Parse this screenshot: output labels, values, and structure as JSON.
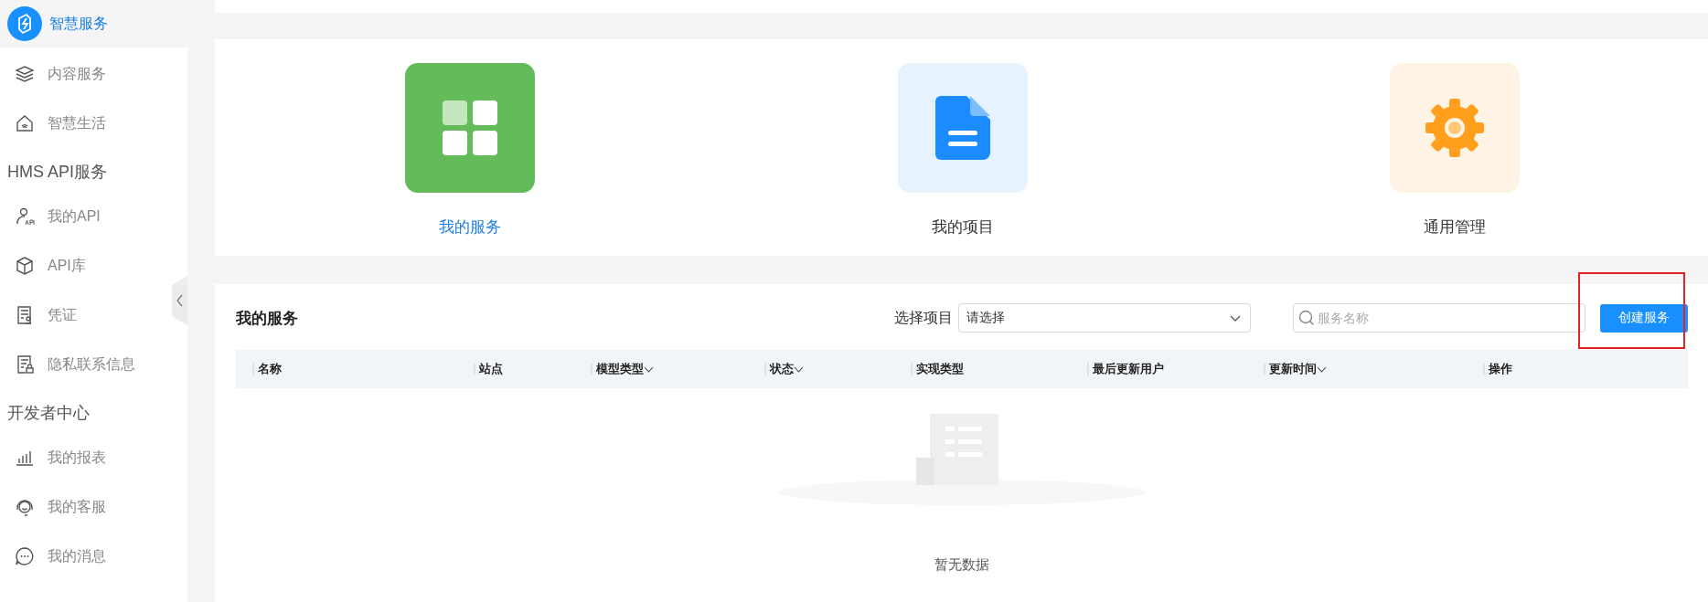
{
  "sidebar": {
    "groups": [
      {
        "items": [
          {
            "label": "智慧服务",
            "selected": true
          },
          {
            "label": "内容服务",
            "selected": false
          },
          {
            "label": "智慧生活",
            "selected": false
          }
        ]
      },
      {
        "title": "HMS API服务",
        "items": [
          {
            "label": "我的API",
            "selected": false
          },
          {
            "label": "API库",
            "selected": false
          },
          {
            "label": "凭证",
            "selected": false
          },
          {
            "label": "隐私联系信息",
            "selected": false
          }
        ]
      },
      {
        "title": "开发者中心",
        "items": [
          {
            "label": "我的报表",
            "selected": false
          },
          {
            "label": "我的客服",
            "selected": false
          },
          {
            "label": "我的消息",
            "selected": false
          }
        ]
      }
    ]
  },
  "quick_links": [
    {
      "kind": "grid",
      "label": "我的服务",
      "selected": true
    },
    {
      "kind": "document",
      "label": "我的项目",
      "selected": false
    },
    {
      "kind": "gear",
      "label": "通用管理",
      "selected": false
    }
  ],
  "services": {
    "title": "我的服务",
    "project_label": "选择项目",
    "project_select": {
      "placeholder": "请选择"
    },
    "search": {
      "placeholder": "服务名称"
    },
    "create_button": "创建服务",
    "columns": [
      {
        "label": "名称",
        "sortable": false
      },
      {
        "label": "站点",
        "sortable": false
      },
      {
        "label": "模型类型",
        "sortable": true
      },
      {
        "label": "状态",
        "sortable": true
      },
      {
        "label": "实现类型",
        "sortable": false
      },
      {
        "label": "最后更新用户",
        "sortable": false
      },
      {
        "label": "更新时间",
        "sortable": true
      },
      {
        "label": "操作",
        "sortable": false
      }
    ],
    "empty_text": "暂无数据"
  }
}
